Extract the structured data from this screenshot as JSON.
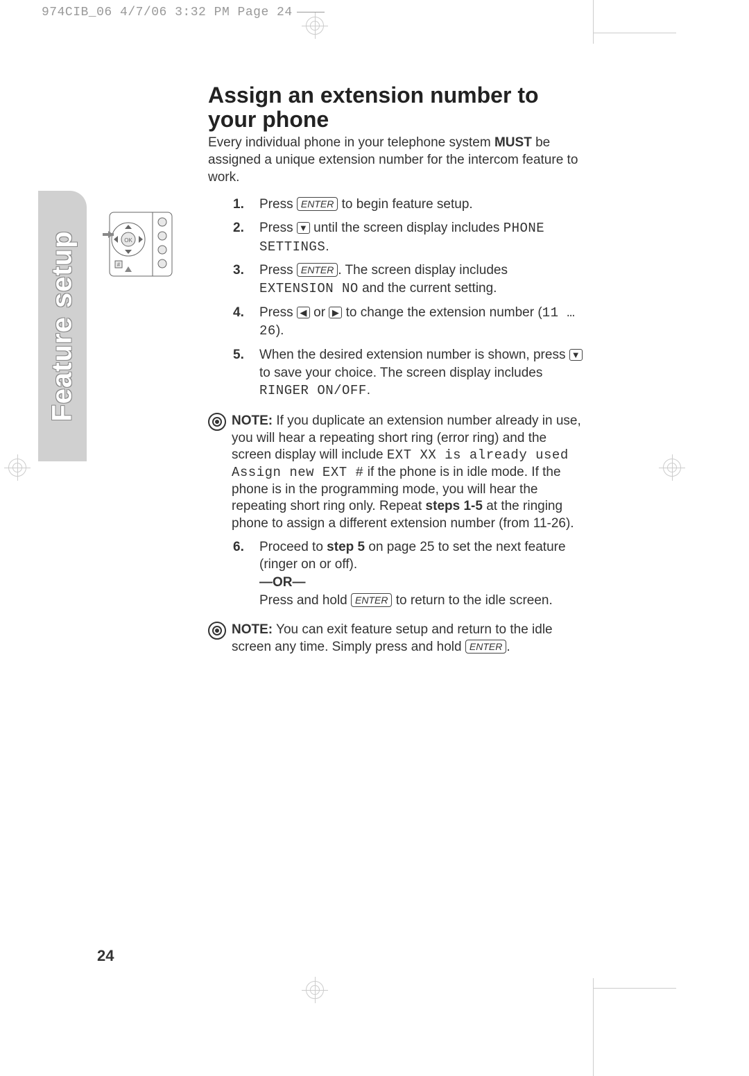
{
  "prepress": {
    "slug": "974CIB_06  4/7/06  3:32 PM  Page 24"
  },
  "side_tab": {
    "label": "Feature setup"
  },
  "heading": "Assign an extension number to your phone",
  "intro": {
    "pre": "Every individual phone in your telephone system ",
    "must": "MUST",
    "post": " be assigned a unique extension number for the intercom feature to work."
  },
  "keys": {
    "enter": "ENTER"
  },
  "steps": {
    "s1": {
      "num": "1.",
      "a": "Press ",
      "b": " to begin feature setup."
    },
    "s2": {
      "num": "2.",
      "a": "Press ",
      "b": " until the screen display includes ",
      "lcd": "PHONE SETTINGS",
      "c": "."
    },
    "s3": {
      "num": "3.",
      "a": "Press ",
      "b": ". The screen display includes ",
      "lcd": "EXTENSION NO",
      "c": " and the current setting."
    },
    "s4": {
      "num": "4.",
      "a": "Press ",
      "b": " or ",
      "c": " to change the extension number (",
      "lcd": "11 … 26",
      "d": ")."
    },
    "s5": {
      "num": "5.",
      "a": "When the desired extension number is shown, press ",
      "b": " to save your choice.  The screen display includes ",
      "lcd": "RINGER ON/OFF",
      "c": "."
    },
    "s6": {
      "num": "6.",
      "a": "Proceed to ",
      "stepref": "step 5",
      "b": " on page 25 to set the next feature (ringer on or off).",
      "or": "—OR—",
      "c": "Press and hold ",
      "d": " to return to the idle screen."
    }
  },
  "note1": {
    "lead": "NOTE:",
    "a": " If you duplicate an extension number already in use, you will hear a repeating short ring (error ring) and the screen display will include ",
    "lcd": "EXT XX is already used Assign new EXT #",
    "b": " if the phone is in idle mode.  If the phone is in the programming mode, you will hear the repeating short ring only.  Repeat ",
    "steps": "steps 1-5",
    "c": " at the ringing phone to assign a different extension number (from 11-26)."
  },
  "note2": {
    "lead": "NOTE:",
    "a": " You can exit feature setup and return to the idle screen any time.  Simply press and hold ",
    "b": "."
  },
  "page_number": "24"
}
